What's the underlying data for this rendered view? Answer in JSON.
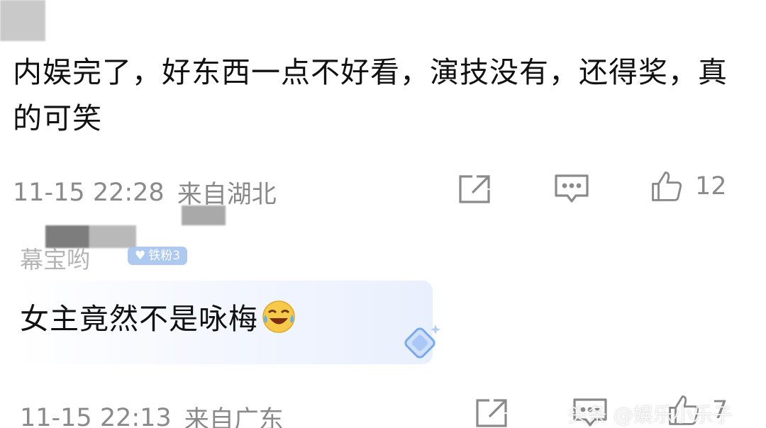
{
  "comment1": {
    "text": "内娱完了，好东西一点不好看，演技没有，还得奖，真的可笑",
    "time": "11-15 22:28",
    "location": "来自湖北",
    "likes": "12"
  },
  "comment2": {
    "username": "幕宝哟",
    "badge": "铁粉3",
    "text": "女主竟然不是咏梅",
    "time": "11-15 22:13",
    "location": "来自广东",
    "likes": "7"
  },
  "icons": {
    "share": "share-icon",
    "reply": "comment-icon",
    "like": "thumbs-up-icon",
    "emoji": "laughing-crying-emoji",
    "diamond": "diamond-sparkle-icon"
  },
  "watermark": "头条 @娱乐小乐子"
}
